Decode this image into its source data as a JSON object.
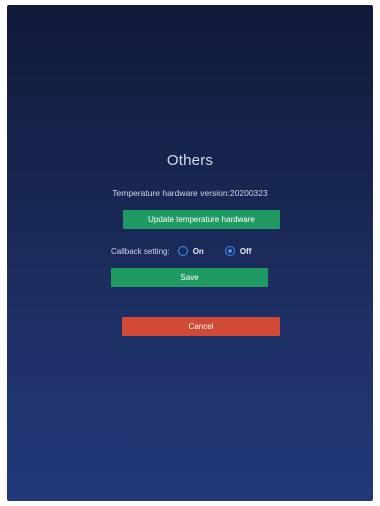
{
  "dialog": {
    "title": "Others",
    "version_text": "Temperature hardware version:20200323",
    "update_button_label": "Update temperature hardware",
    "callback": {
      "label": "Callback setting:",
      "options": [
        {
          "label": "On",
          "selected": false
        },
        {
          "label": "Off",
          "selected": true
        }
      ]
    },
    "save_button_label": "Save",
    "cancel_button_label": "Cancel"
  },
  "colors": {
    "background_top": "#101a3a",
    "background_bottom": "#22387a",
    "primary_button": "#1f9a62",
    "cancel_button": "#d24a36",
    "radio_accent": "#3d8ff5"
  }
}
